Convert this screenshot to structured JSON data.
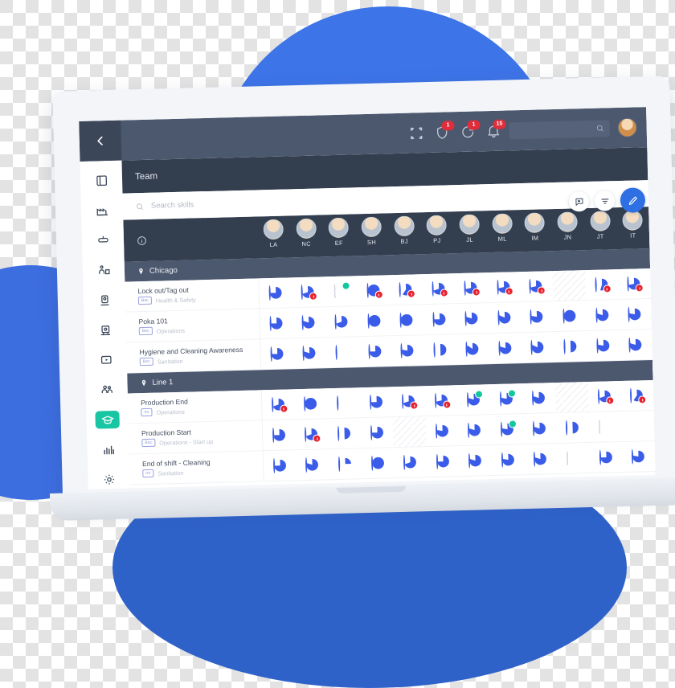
{
  "topbar": {
    "back_label": "back",
    "icons": [
      {
        "name": "scan-frame-icon",
        "badge": ""
      },
      {
        "name": "shield-icon",
        "badge": "1"
      },
      {
        "name": "sync-icon",
        "badge": "1"
      },
      {
        "name": "bell-icon",
        "badge": "15"
      }
    ],
    "search_placeholder": "",
    "avatar_label": "user-avatar"
  },
  "sidebar": {
    "items": [
      {
        "name": "sidebar-item-dashboard",
        "icon": "dashboard-icon",
        "active": false
      },
      {
        "name": "sidebar-item-factory",
        "icon": "factory-icon",
        "active": false
      },
      {
        "name": "sidebar-item-line",
        "icon": "conveyor-icon",
        "active": false
      },
      {
        "name": "sidebar-item-station",
        "icon": "station-icon",
        "active": false
      },
      {
        "name": "sidebar-item-machine",
        "icon": "machine-icon",
        "active": false
      },
      {
        "name": "sidebar-item-equipment",
        "icon": "equipment-icon",
        "active": false
      },
      {
        "name": "sidebar-item-video",
        "icon": "video-icon",
        "active": false
      },
      {
        "name": "sidebar-item-people",
        "icon": "people-icon",
        "active": false
      },
      {
        "name": "sidebar-item-skills",
        "icon": "graduation-cap-icon",
        "active": true
      },
      {
        "name": "sidebar-item-analytics",
        "icon": "bar-chart-icon",
        "active": false
      },
      {
        "name": "sidebar-item-settings",
        "icon": "gear-icon",
        "active": false
      }
    ]
  },
  "page": {
    "title": "Team",
    "search_placeholder": "Search skills"
  },
  "actions": [
    {
      "name": "comment-button",
      "icon": "comment-flag-icon"
    },
    {
      "name": "filter-button",
      "icon": "filter-icon"
    },
    {
      "name": "edit-button",
      "icon": "pencil-icon"
    }
  ],
  "matrix": {
    "info_icon": "info-icon",
    "people": [
      {
        "initials": "LA"
      },
      {
        "initials": "NC"
      },
      {
        "initials": "EF"
      },
      {
        "initials": "SH"
      },
      {
        "initials": "BJ"
      },
      {
        "initials": "PJ"
      },
      {
        "initials": "JL"
      },
      {
        "initials": "ML"
      },
      {
        "initials": "IM"
      },
      {
        "initials": "JN"
      },
      {
        "initials": "JT"
      },
      {
        "initials": "IT"
      }
    ],
    "groups": [
      {
        "name": "Chicago",
        "rows": [
          {
            "skill": "Lock out/Tag out",
            "pill": "Bsc",
            "category": "Health & Safety",
            "cells": [
              {
                "pct": 75,
                "alert": false
              },
              {
                "pct": 70,
                "alert": true
              },
              {
                "pct": 0,
                "dashed": true,
                "check": true
              },
              {
                "pct": 100,
                "alert": true
              },
              {
                "pct": 60,
                "alert": true
              },
              {
                "pct": 70,
                "alert": true
              },
              {
                "pct": 72,
                "alert": true
              },
              {
                "pct": 72,
                "alert": true
              },
              {
                "pct": 72,
                "alert": true
              },
              {
                "pct": 0,
                "na": true
              },
              {
                "pct": 55,
                "alert": true
              },
              {
                "pct": 72,
                "alert": true
              }
            ]
          },
          {
            "skill": "Poka 101",
            "pill": "Bsc",
            "category": "Operations",
            "cells": [
              {
                "pct": 75,
                "alert": false
              },
              {
                "pct": 80,
                "alert": false
              },
              {
                "pct": 70,
                "alert": false
              },
              {
                "pct": 100,
                "alert": false
              },
              {
                "pct": 100,
                "alert": false
              },
              {
                "pct": 75,
                "alert": false
              },
              {
                "pct": 80,
                "alert": false
              },
              {
                "pct": 82,
                "alert": false
              },
              {
                "pct": 78,
                "alert": false
              },
              {
                "pct": 100,
                "alert": false
              },
              {
                "pct": 80,
                "alert": false
              },
              {
                "pct": 78,
                "alert": false
              }
            ]
          },
          {
            "skill": "Hygiene and Cleaning Awareness",
            "pill": "Bsc",
            "category": "Sanitation",
            "cells": [
              {
                "pct": 75,
                "alert": false
              },
              {
                "pct": 80,
                "alert": false
              },
              {
                "pct": 0,
                "alert": false
              },
              {
                "pct": 75,
                "alert": false
              },
              {
                "pct": 78,
                "alert": false
              },
              {
                "pct": 50,
                "alert": false
              },
              {
                "pct": 85,
                "alert": false
              },
              {
                "pct": 80,
                "alert": false
              },
              {
                "pct": 82,
                "alert": false
              },
              {
                "pct": 50,
                "alert": false
              },
              {
                "pct": 78,
                "alert": false
              },
              {
                "pct": 80,
                "alert": false
              }
            ]
          }
        ]
      },
      {
        "name": "Line 1",
        "rows": [
          {
            "skill": "Production End",
            "pill": "Int",
            "category": "Operations",
            "cells": [
              {
                "pct": 70,
                "alert": true
              },
              {
                "pct": 100,
                "alert": false
              },
              {
                "pct": 0,
                "alert": false
              },
              {
                "pct": 75,
                "alert": false
              },
              {
                "pct": 70,
                "alert": true
              },
              {
                "pct": 72,
                "alert": true
              },
              {
                "pct": 80,
                "check": true
              },
              {
                "pct": 78,
                "check": true
              },
              {
                "pct": 80,
                "alert": false
              },
              {
                "pct": 0,
                "na": true
              },
              {
                "pct": 70,
                "alert": true
              },
              {
                "pct": 60,
                "alert": true
              }
            ]
          },
          {
            "skill": "Production Start",
            "pill": "Bsc",
            "category": "Operations - Start up",
            "cells": [
              {
                "pct": 75,
                "alert": false
              },
              {
                "pct": 70,
                "alert": true
              },
              {
                "pct": 50,
                "alert": false
              },
              {
                "pct": 75,
                "alert": false
              },
              {
                "pct": 0,
                "na": true
              },
              {
                "pct": 78,
                "alert": false
              },
              {
                "pct": 80,
                "alert": false
              },
              {
                "pct": 78,
                "check": true
              },
              {
                "pct": 80,
                "alert": false
              },
              {
                "pct": 50,
                "alert": false
              },
              {
                "pct": 0,
                "dashed": true
              }
            ]
          },
          {
            "skill": "End of shift - Cleaning",
            "pill": "Int",
            "category": "Sanitation",
            "cells": [
              {
                "pct": 75,
                "alert": false
              },
              {
                "pct": 80,
                "alert": false
              },
              {
                "pct": 25,
                "alert": false
              },
              {
                "pct": 100,
                "alert": false
              },
              {
                "pct": 70,
                "alert": false
              },
              {
                "pct": 75,
                "alert": false
              },
              {
                "pct": 80,
                "alert": false
              },
              {
                "pct": 78,
                "alert": false
              },
              {
                "pct": 80,
                "alert": false
              },
              {
                "pct": 0,
                "dashed": true
              },
              {
                "pct": 75,
                "alert": false
              },
              {
                "pct": 78,
                "alert": false
              }
            ]
          }
        ]
      }
    ]
  },
  "colors": {
    "accent_blue": "#3b5ce8",
    "active_teal": "#19c6a4",
    "alert_red": "#e8232f",
    "header_dark": "#333e4f",
    "chrome_dark": "#4c586e",
    "decor_blue": "#3d74e8"
  }
}
